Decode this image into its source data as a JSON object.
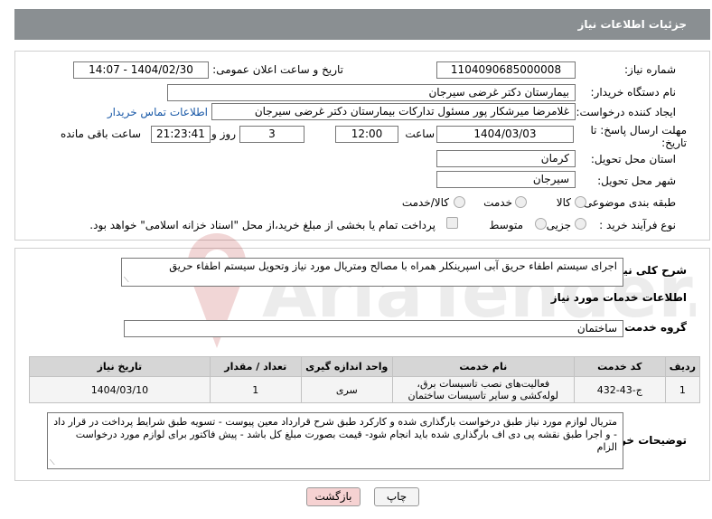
{
  "header": {
    "title": "جزئیات اطلاعات نیاز"
  },
  "fields": {
    "need_number_label": "شماره نیاز:",
    "need_number": "1104090685000008",
    "announce_label": "تاریخ و ساعت اعلان عمومی:",
    "announce_value": "1404/02/30 - 14:07",
    "buyer_org_label": "نام دستگاه خریدار:",
    "buyer_org": "بیمارستان دکتر غرضی سیرجان",
    "creator_label": "ایجاد کننده درخواست:",
    "creator": "غلامرضا میرشکار پور مسئول تدارکات بیمارستان دکتر غرضی سیرجان",
    "contact_link": "اطلاعات تماس خریدار",
    "deadline_label": "مهلت ارسال پاسخ: تا تاریخ:",
    "deadline_date": "1404/03/03",
    "hour_label": "ساعت",
    "deadline_time": "12:00",
    "days_value": "3",
    "days_label": "روز و",
    "remaining_time": "21:23:41",
    "remaining_label": "ساعت باقی مانده",
    "province_label": "استان محل تحویل:",
    "province": "کرمان",
    "city_label": "شهر محل تحویل:",
    "city": "سیرجان",
    "category_label": "طبقه بندی موضوعی:",
    "category_options": [
      "کالا",
      "خدمت",
      "کالا/خدمت"
    ],
    "process_label": "نوع فرآیند خرید :",
    "process_options": [
      "جزیی",
      "متوسط"
    ],
    "payment_text": "پرداخت تمام یا بخشی از مبلغ خرید،از محل \"اسناد خزانه اسلامی\" خواهد بود."
  },
  "summary": {
    "label": "شرح کلی نیاز:",
    "text": "اجرای سیستم اطفاء حریق آبی اسپرینکلر همراه با مصالح ومتریال مورد نیاز وتحویل سیستم اطفاء حریق"
  },
  "services": {
    "section_title": "اطلاعات خدمات مورد نیاز",
    "group_label": "گروه خدمت:",
    "group_value": "ساختمان",
    "columns": [
      "ردیف",
      "کد خدمت",
      "نام خدمت",
      "واحد اندازه گیری",
      "تعداد / مقدار",
      "تاریخ نیاز"
    ],
    "rows": [
      [
        "1",
        "ج-43-432",
        "فعالیت‌های نصب تاسیسات برق، لوله‌کشی و سایر تاسیسات ساختمان",
        "سری",
        "1",
        "1404/03/10"
      ]
    ]
  },
  "buyer_notes": {
    "label": "توضیحات خریدار:",
    "text": "متریال لوازم مورد نیاز طبق درخواست بارگذاری شده و کارکرد طبق شرح قرارداد معین پیوست - تسویه طبق شرایط پرداخت در قرار داد - و اجرا طبق نقشه پی دی اف بارگذاری شده باید انجام شود- قیمت  بصورت مبلغ کل باشد - پیش فاکتور برای لوازم مورد درخواست الزام"
  },
  "buttons": {
    "print": "چاپ",
    "back": "بازگشت"
  },
  "watermark": {
    "text": "AriaTender.neT"
  },
  "colors": {
    "header_bg": "#8a8f92",
    "link": "#1b5aa8",
    "back_btn_bg": "#f6d2d2"
  }
}
